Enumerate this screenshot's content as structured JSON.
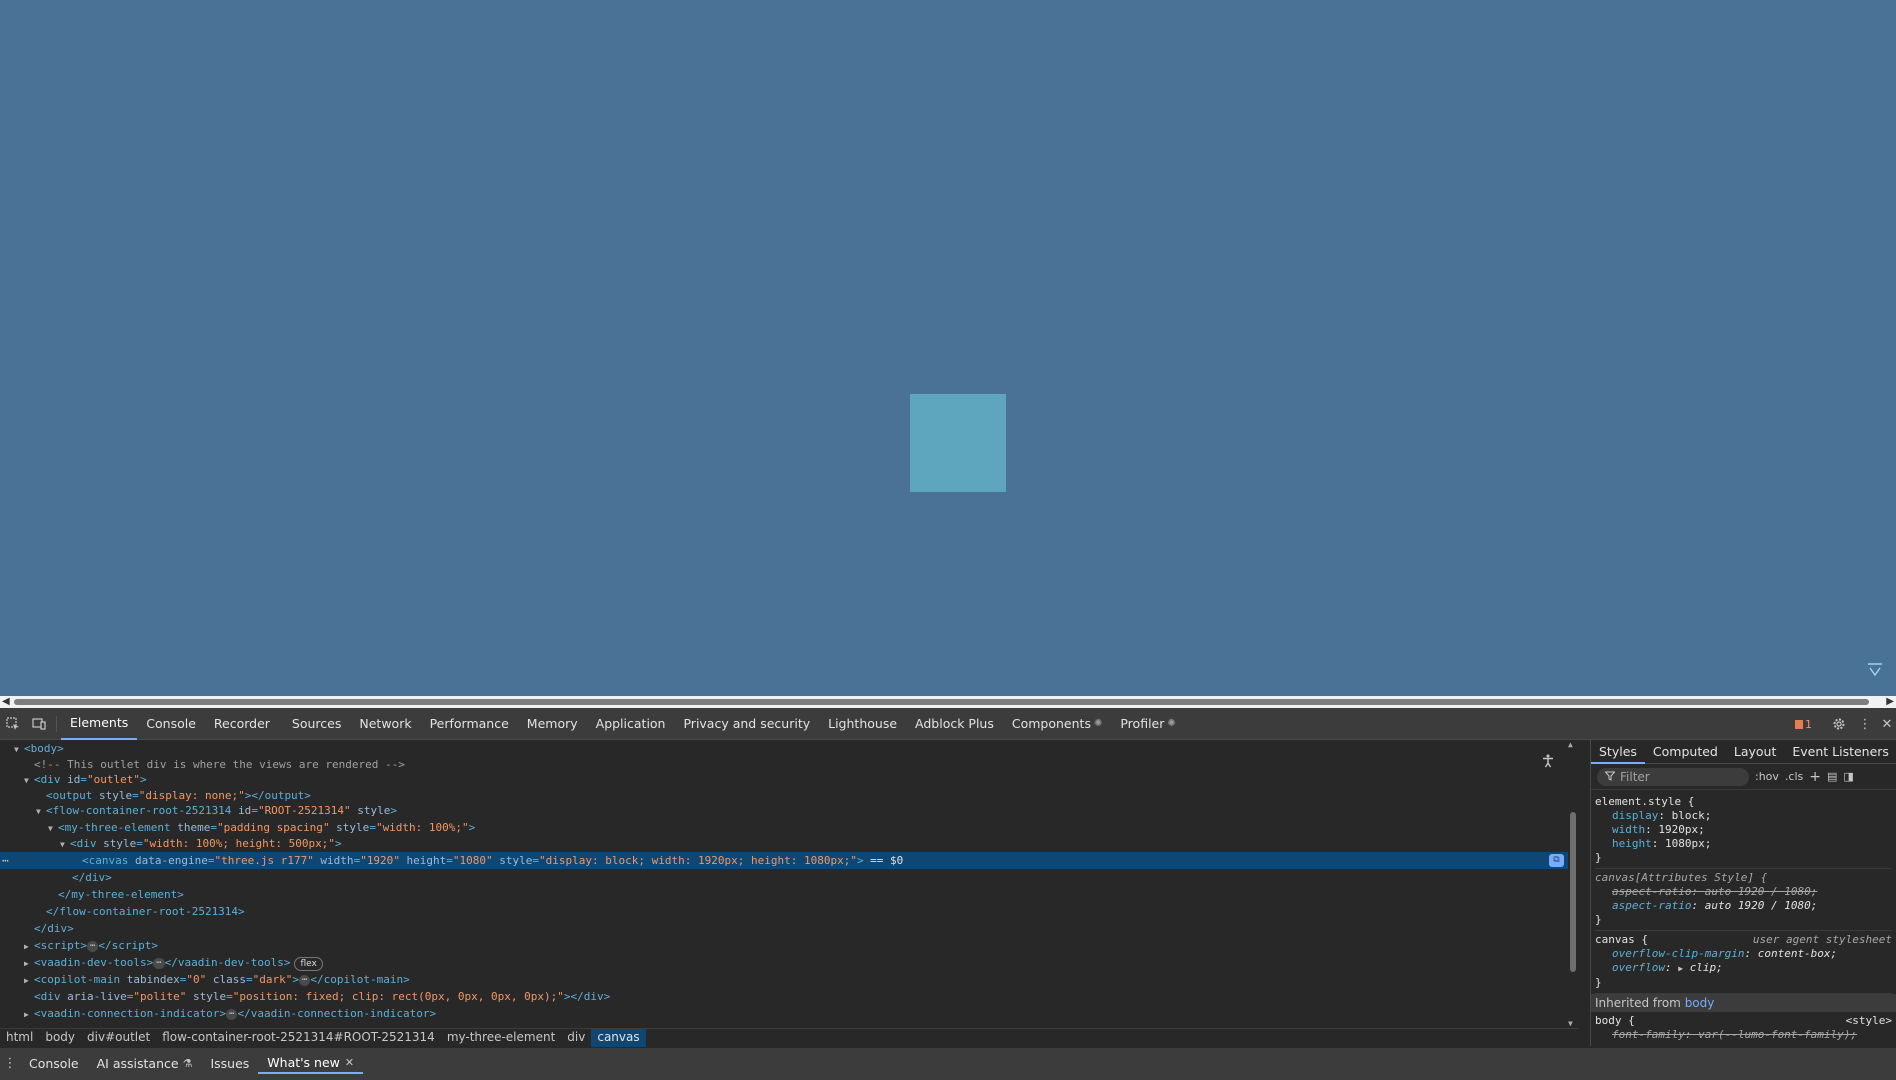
{
  "devtools": {
    "main_tabs": [
      "Elements",
      "Console",
      "Recorder",
      "Sources",
      "Network",
      "Performance",
      "Memory",
      "Application",
      "Privacy and security",
      "Lighthouse",
      "Adblock Plus",
      "Components",
      "Profiler"
    ],
    "issues_count": "1",
    "elements": {
      "comment": "<!-- This outlet div is where the views are rendered -->",
      "selected_suffix": " == $0",
      "canvas_data_engine": "three.js r177",
      "canvas_width": "1920",
      "canvas_height": "1080",
      "canvas_style": "display: block; width: 1920px; height: 1080px;",
      "flow_id": "ROOT-2521314",
      "mte_theme": "padding spacing",
      "mte_style": "width: 100%;",
      "div_style": "width: 100%; height: 500px;",
      "output_style": "display: none;",
      "aria_style": "position: fixed; clip: rect(0px, 0px, 0px, 0px);"
    },
    "breadcrumbs": [
      "html",
      "body",
      "div#outlet",
      "flow-container-root-2521314#ROOT-2521314",
      "my-three-element",
      "div",
      "canvas"
    ],
    "drawer_tabs": [
      "Console",
      "AI assistance",
      "Issues",
      "What's new"
    ],
    "styles_pane": {
      "tabs": [
        "Styles",
        "Computed",
        "Layout",
        "Event Listeners"
      ],
      "filter_placeholder": "Filter",
      "hov": ":hov",
      "cls": ".cls",
      "element_style_selector": "element.style {",
      "element_style_props": [
        {
          "name": "display",
          "value": "block;"
        },
        {
          "name": "width",
          "value": "1920px;"
        },
        {
          "name": "height",
          "value": "1080px;"
        }
      ],
      "attr_selector": "canvas[Attributes Style] {",
      "attr_props": [
        {
          "name": "aspect-ratio",
          "value": "auto 1920 / 1080;"
        },
        {
          "name": "aspect-ratio",
          "value": "auto 1920 / 1080;"
        }
      ],
      "ua_selector": "canvas {",
      "ua_origin": "user agent stylesheet",
      "ua_props": [
        {
          "name": "overflow-clip-margin",
          "value": "content-box;"
        },
        {
          "name": "overflow",
          "value": "clip;"
        }
      ],
      "inherited_label": "Inherited from",
      "inherited_link": "body",
      "body_selector": "body {",
      "body_origin": "<style>",
      "body_partial": "font-family: var(--lumo-font-family);"
    }
  }
}
